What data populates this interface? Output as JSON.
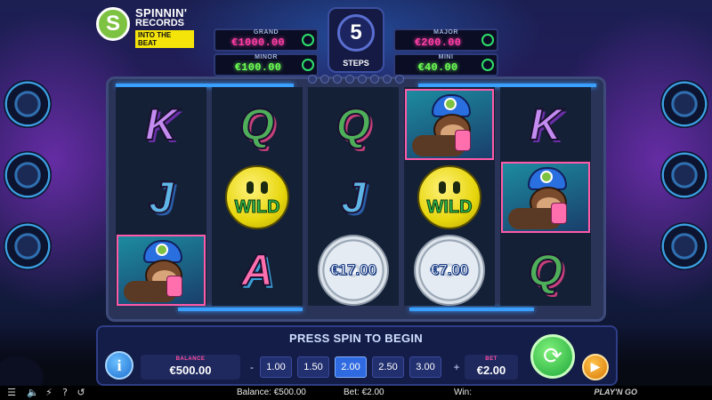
{
  "game": {
    "logo": {
      "line1": "SPINNIN'",
      "line2": "RECORDS",
      "line3": "INTO THE BEAT",
      "badge": "S"
    },
    "jackpots": {
      "grand": {
        "label": "GRAND",
        "value": "€1000.00"
      },
      "minor": {
        "label": "MINOR",
        "value": "€100.00"
      },
      "major": {
        "label": "MAJOR",
        "value": "€200.00"
      },
      "mini": {
        "label": "MINI",
        "value": "€40.00"
      }
    },
    "steps": {
      "count": "5",
      "label": "STEPS"
    },
    "reels": [
      [
        {
          "type": "letter",
          "value": "K"
        },
        {
          "type": "letter",
          "value": "J"
        },
        {
          "type": "monkey"
        }
      ],
      [
        {
          "type": "letter",
          "value": "Q"
        },
        {
          "type": "wild",
          "value": "WILD"
        },
        {
          "type": "letter",
          "value": "A"
        }
      ],
      [
        {
          "type": "letter",
          "value": "Q"
        },
        {
          "type": "letter",
          "value": "J"
        },
        {
          "type": "disc",
          "value": "€17.00"
        }
      ],
      [
        {
          "type": "monkey"
        },
        {
          "type": "wild",
          "value": "WILD"
        },
        {
          "type": "disc",
          "value": "€7.00"
        }
      ],
      [
        {
          "type": "letter",
          "value": "K"
        },
        {
          "type": "monkey"
        },
        {
          "type": "letter",
          "value": "Q"
        }
      ]
    ],
    "message": "PRESS SPIN TO BEGIN",
    "balance": {
      "label": "BALANCE",
      "value": "€500.00"
    },
    "bet": {
      "label": "BET",
      "value": "€2.00"
    },
    "bet_options": [
      "1.00",
      "1.50",
      "2.00",
      "2.50",
      "3.00"
    ],
    "bet_selected": "2.00",
    "bet_decrease": "-",
    "bet_increase": "+",
    "info_label": "i",
    "spin_icon": "⟳",
    "autoplay_icon": "▶"
  },
  "status_bar": {
    "balance_text": "Balance: €500.00",
    "bet_text": "Bet: €2.00",
    "win_text": "Win:",
    "brand": "PLAY'N GO",
    "icons": [
      "menu-icon",
      "sound-icon",
      "turbo-icon",
      "help-icon",
      "history-icon"
    ]
  },
  "colors": {
    "jackpot_pink": "#ff3fa6",
    "jackpot_green": "#6cff54",
    "spin_green": "#1ea83a",
    "autoplay_orange": "#d77a07",
    "selected_bet": "#2f6ae0"
  }
}
